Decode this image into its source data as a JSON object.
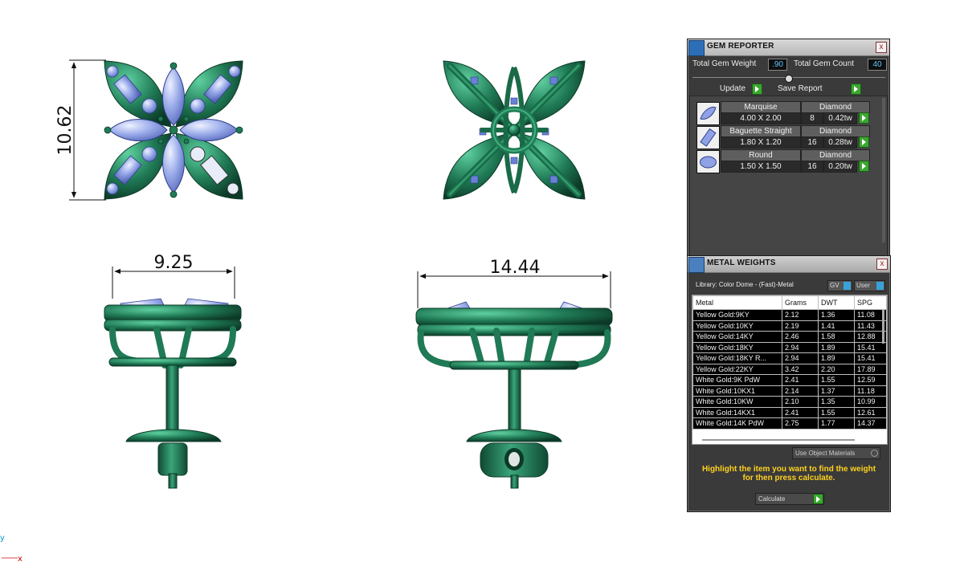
{
  "dimensions": {
    "height": "10.62",
    "width_side": "9.25",
    "width_front": "14.44"
  },
  "gem_reporter": {
    "title": "GEM REPORTER",
    "close": "x",
    "total_gem_weight_label": "Total Gem Weight",
    "total_gem_weight_value": ".90",
    "total_gem_count_label": "Total Gem Count",
    "total_gem_count_value": "40",
    "update_label": "Update",
    "save_report_label": "Save Report",
    "gems": [
      {
        "shape": "Marquise",
        "size": "4.00 X 2.00",
        "material": "Diamond",
        "count": "8",
        "weight": "0.42tw"
      },
      {
        "shape": "Baguette Straight",
        "size": "1.80 X 1.20",
        "material": "Diamond",
        "count": "16",
        "weight": "0.28tw"
      },
      {
        "shape": "Round",
        "size": "1.50 X 1.50",
        "material": "Diamond",
        "count": "16",
        "weight": "0.20tw"
      }
    ]
  },
  "metal_weights": {
    "title": "METAL WEIGHTS",
    "close": "x",
    "library": "Library: Color Dome - (Fast)-Metal",
    "gv_label": "GV",
    "user_label": "User",
    "columns": [
      "Metal",
      "Grams",
      "DWT",
      "SPG"
    ],
    "rows": [
      [
        "Yellow Gold:9KY",
        "2.12",
        "1.36",
        "11.08"
      ],
      [
        "Yellow Gold:10KY",
        "2.19",
        "1.41",
        "11.43"
      ],
      [
        "Yellow Gold:14KY",
        "2.46",
        "1.58",
        "12.88"
      ],
      [
        "Yellow Gold:18KY",
        "2.94",
        "1.89",
        "15.41"
      ],
      [
        "Yellow Gold:18KY R...",
        "2.94",
        "1.89",
        "15.41"
      ],
      [
        "Yellow Gold:22KY",
        "3.42",
        "2.20",
        "17.89"
      ],
      [
        "White Gold:9K PdW",
        "2.41",
        "1.55",
        "12.59"
      ],
      [
        "White Gold:10KX1",
        "2.14",
        "1.37",
        "11.18"
      ],
      [
        "White Gold:10KW",
        "2.10",
        "1.35",
        "10.99"
      ],
      [
        "White Gold:14KX1",
        "2.41",
        "1.55",
        "12.61"
      ],
      [
        "White Gold:14K PdW",
        "2.75",
        "1.77",
        "14.37"
      ]
    ],
    "use_object_materials": "Use Object Materials",
    "hint": "Highlight the item you want to find the weight for then press calculate.",
    "calculate_label": "Calculate"
  },
  "axis": {
    "y": "y",
    "x": "x"
  },
  "colors": {
    "metal": "#1f7a55",
    "gem": "#8fa2e6",
    "hint": "#ffd21e",
    "go": "#3aa830"
  }
}
